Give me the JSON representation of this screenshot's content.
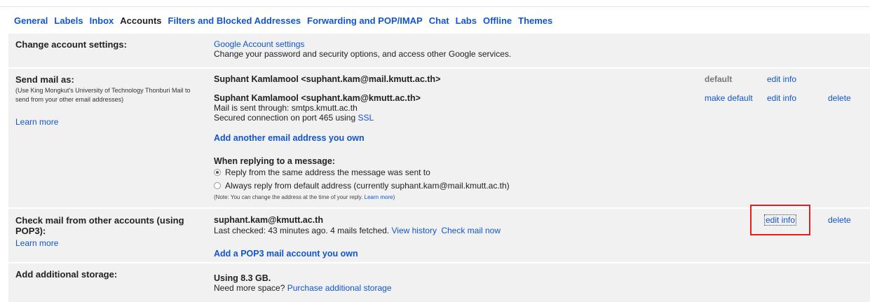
{
  "tabs": [
    {
      "label": "General"
    },
    {
      "label": "Labels"
    },
    {
      "label": "Inbox"
    },
    {
      "label": "Accounts"
    },
    {
      "label": "Filters and Blocked Addresses"
    },
    {
      "label": "Forwarding and POP/IMAP"
    },
    {
      "label": "Chat"
    },
    {
      "label": "Labs"
    },
    {
      "label": "Offline"
    },
    {
      "label": "Themes"
    }
  ],
  "change": {
    "label": "Change account settings:",
    "link": "Google Account settings",
    "desc": "Change your password and security options, and access other Google services."
  },
  "sendmail": {
    "label": "Send mail as:",
    "note": "(Use King Mongkut's University of Technology Thonburi Mail to send from your other email addresses)",
    "learn": "Learn more",
    "addr1": "Suphant Kamlamool <suphant.kam@mail.kmutt.ac.th>",
    "addr1_default": "default",
    "addr1_edit": "edit info",
    "addr2": "Suphant Kamlamool <suphant.kam@kmutt.ac.th>",
    "addr2_sent": "Mail is sent through: smtps.kmutt.ac.th",
    "addr2_secured": "Secured connection on port 465 using ",
    "addr2_ssl": "SSL",
    "addr2_make_default": "make default",
    "addr2_edit": "edit info",
    "addr2_delete": "delete",
    "add_another": "Add another email address you own",
    "reply_heading": "When replying to a message:",
    "reply_opt1": "Reply from the same address the message was sent to",
    "reply_opt2": "Always reply from default address (currently suphant.kam@mail.kmutt.ac.th)",
    "reply_note": "(Note: You can change the address at the time of your reply. ",
    "reply_note_link": "Learn more",
    "reply_note_end": ")"
  },
  "checkmail": {
    "label": "Check mail from other accounts (using POP3):",
    "learn": "Learn more",
    "account": "suphant.kam@kmutt.ac.th",
    "status": "Last checked: 43 minutes ago. 4 mails fetched.",
    "view_history": "View history",
    "check_now": "Check mail now",
    "edit": "edit info",
    "delete": "delete",
    "add_pop3": "Add a POP3 mail account you own"
  },
  "storage": {
    "label": "Add additional storage:",
    "using": "Using 8.3 GB.",
    "need": "Need more space?",
    "purchase": "Purchase additional storage"
  }
}
